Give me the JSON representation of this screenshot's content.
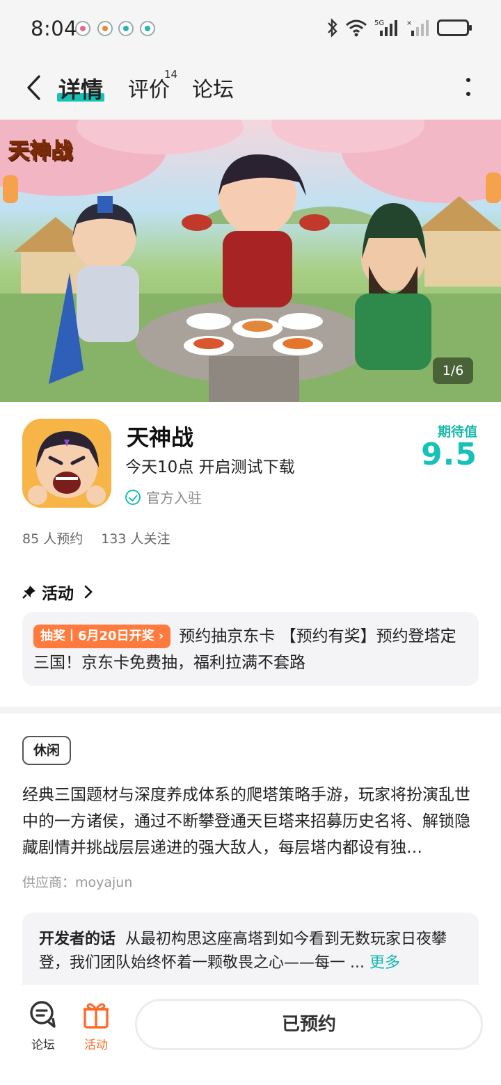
{
  "status_bar": {
    "time": "8:04"
  },
  "header": {
    "tabs": [
      {
        "label": "详情"
      },
      {
        "label": "评价",
        "count": "14"
      },
      {
        "label": "论坛"
      }
    ]
  },
  "banner": {
    "logo_text": "天神战",
    "counter": "1/6"
  },
  "app": {
    "name": "天神战",
    "subtitle": "今天10点 开启测试下载",
    "verified_label": "官方入驻",
    "expect_label": "期待值",
    "expect_score": "9.5",
    "reservations": "85 人预约",
    "followers": "133 人关注"
  },
  "activity": {
    "title": "活动",
    "tag": "抽奖丨6月20日开奖",
    "text": "预约抽京东卡 【预约有奖】预约登塔定三国！京东卡免费抽，福利拉满不套路"
  },
  "details": {
    "genre_tag": "休闲",
    "description": "经典三国题材与深度养成体系的爬塔策略手游，玩家将扮演乱世中的一方诸侯，通过不断攀登通天巨塔来招募历史名将、解锁隐藏剧情并挑战层层递进的强大敌人，每层塔内都设有独…",
    "supplier": "供应商：moyajun"
  },
  "developer": {
    "label": "开发者的话",
    "text": "从最初构思这座高塔到如今看到无数玩家日夜攀登，我们团队始终怀着一颗敬畏之心——每一 ...",
    "more": "更多"
  },
  "bottom_bar": {
    "forum_label": "论坛",
    "activity_label": "活动",
    "reserve_button": "已预约"
  },
  "colors": {
    "accent": "#16c2b8",
    "activity_orange": "#ff7a3c"
  }
}
